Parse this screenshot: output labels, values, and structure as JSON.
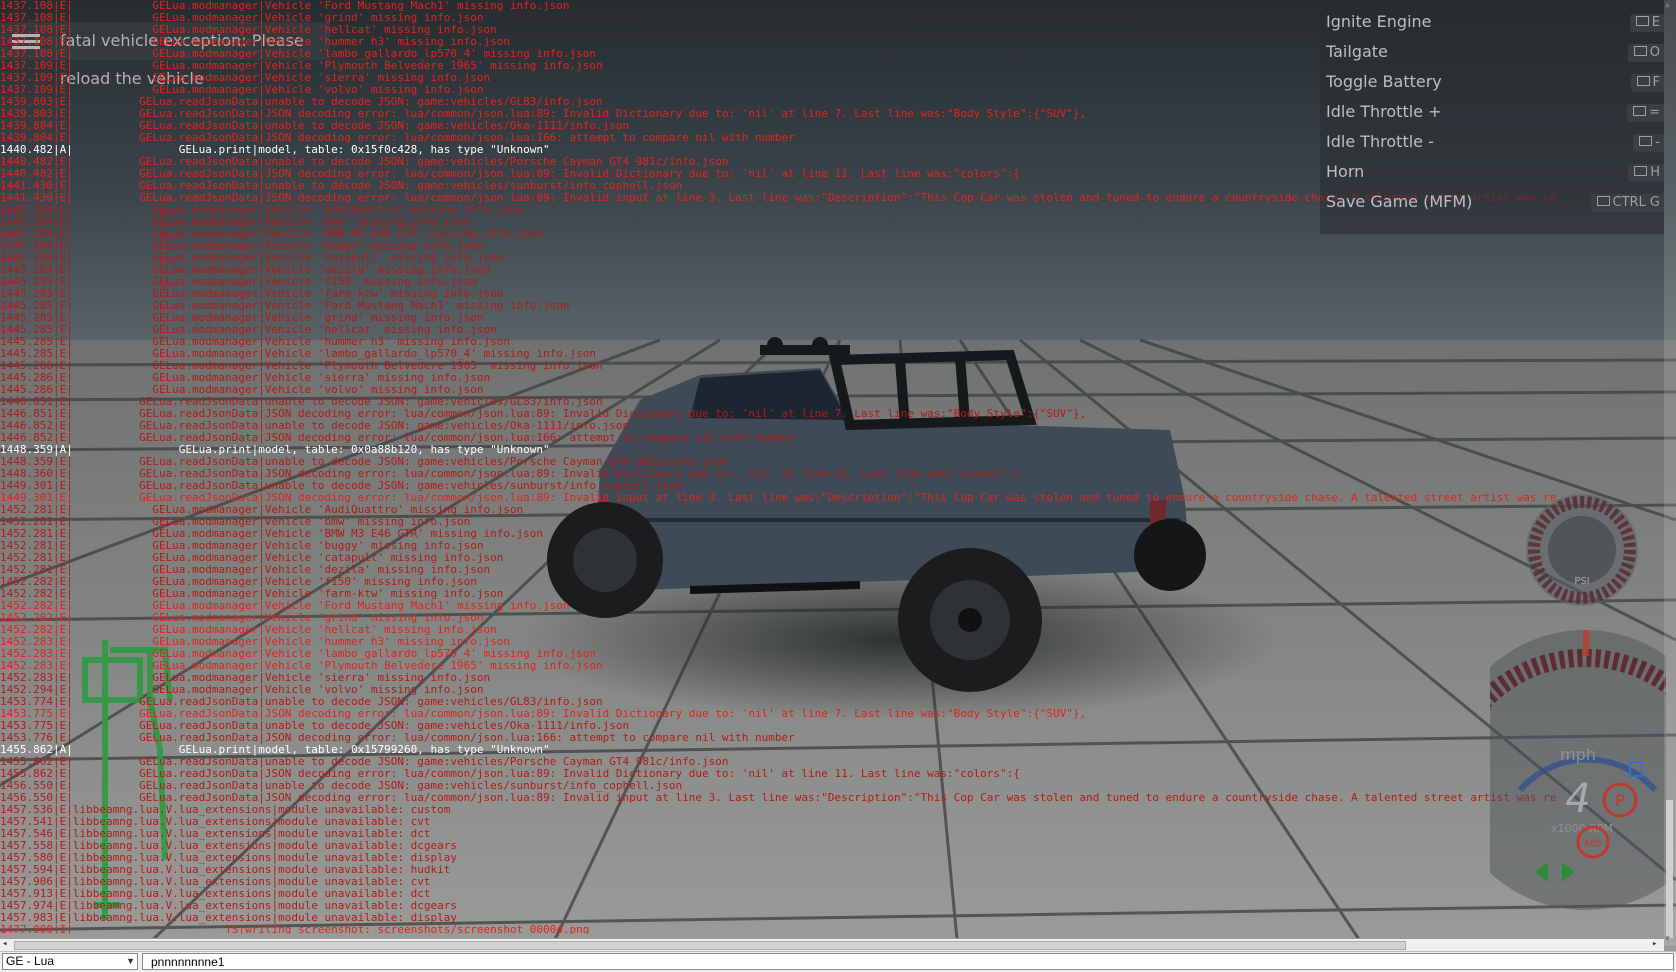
{
  "notice": {
    "text": "fatal vehicle exception: Please reload the vehicle"
  },
  "action_menu": [
    {
      "label": "Ignite Engine",
      "key": "E"
    },
    {
      "label": "Tailgate",
      "key": "O"
    },
    {
      "label": "Toggle Battery",
      "key": "F"
    },
    {
      "label": "Idle Throttle +",
      "key": "="
    },
    {
      "label": "Idle Throttle -",
      "key": "-"
    },
    {
      "label": "Horn",
      "key": "H"
    },
    {
      "label": "Save Game (MFM)",
      "key": "CTRL G"
    }
  ],
  "console_lines": [
    {
      "t": "1437.108|E|            GELua.modmanager|Vehicle 'Ford Mustang Mach1' missing info.json",
      "s": "err"
    },
    {
      "t": "1437.108|E|            GELua.modmanager|Vehicle 'grind' missing info.json",
      "s": "err"
    },
    {
      "t": "1437.108|E|            GELua.modmanager|Vehicle 'hellcat' missing info.json",
      "s": "err"
    },
    {
      "t": "1437.108|E|            GELua.modmanager|Vehicle 'hummer h3' missing info.json",
      "s": "err"
    },
    {
      "t": "1437.108|E|            GELua.modmanager|Vehicle 'lambo_gallardo_lp570_4' missing info.json",
      "s": "err"
    },
    {
      "t": "1437.109|E|            GELua.modmanager|Vehicle 'Plymouth Belvedere 1965' missing info.json",
      "s": "err"
    },
    {
      "t": "1437.109|E|            GELua.modmanager|Vehicle 'sierra' missing info.json",
      "s": "err"
    },
    {
      "t": "1437.109|E|            GELua.modmanager|Vehicle 'volvo' missing info.json",
      "s": "err"
    },
    {
      "t": "1439.803|E|          GELua.readJsonData|unable to decode JSON: game:vehicles/GL83/info.json",
      "s": "err"
    },
    {
      "t": "1439.803|E|          GELua.readJsonData|JSON decoding error: lua/common/json.lua:89: Invalid Dictionary due to: 'nil' at line 7. Last line was:\"Body Style\":{\"SUV\"},",
      "s": "err"
    },
    {
      "t": "1439.804|E|          GELua.readJsonData|unable to decode JSON: game:vehicles/Oka-1111/info.json",
      "s": "err"
    },
    {
      "t": "1439.804|E|          GELua.readJsonData|JSON decoding error: lua/common/json.lua:166: attempt to compare nil with number",
      "s": "err"
    },
    {
      "t": "1440.482|A|                GELua.print|model, table: 0x15f0c428, has type \"Unknown\"",
      "s": "info"
    },
    {
      "t": "1440.482|E|          GELua.readJsonData|unable to decode JSON: game:vehicles/Porsche Cayman GT4 981c/info.json",
      "s": "err"
    },
    {
      "t": "1440.482|E|          GELua.readJsonData|JSON decoding error: lua/common/json.lua:89: Invalid Dictionary due to: 'nil' at line 11. Last line was:\"colors\":{",
      "s": "err"
    },
    {
      "t": "1441.430|E|          GELua.readJsonData|unable to decode JSON: game:vehicles/sunburst/info_cophell.json",
      "s": "err"
    },
    {
      "t": "1441.430|E|          GELua.readJsonData|JSON decoding error: lua/common/json.lua:89: Invalid input at line 3. Last line was:\"Description\":\"This Cop Car was stolen and tuned to endure a countryside chase. A talented street artist was re",
      "s": "err"
    },
    {
      "t": "1445.284|E|            GELua.modmanager|Vehicle 'AudiQuattro' missing info.json",
      "s": "faint"
    },
    {
      "t": "1445.284|E|            GELua.modmanager|Vehicle 'bmw' missing info.json",
      "s": "faint"
    },
    {
      "t": "1445.284|E|            GELua.modmanager|Vehicle 'BMW M3 E46 GTR' missing info.json",
      "s": "faint"
    },
    {
      "t": "1445.284|E|            GELua.modmanager|Vehicle 'buggy' missing info.json",
      "s": "faint"
    },
    {
      "t": "1445.284|E|            GELua.modmanager|Vehicle 'catapult' missing info.json",
      "s": "faint"
    },
    {
      "t": "1445.284|E|            GELua.modmanager|Vehicle 'dezila' missing info.json",
      "s": "faint"
    },
    {
      "t": "1445.285|E|            GELua.modmanager|Vehicle 'f150' missing info.json",
      "s": "faint"
    },
    {
      "t": "1445.285|E|            GELua.modmanager|Vehicle 'farm-ktw' missing info.json",
      "s": "faint"
    },
    {
      "t": "1445.285|E|            GELua.modmanager|Vehicle 'Ford Mustang Mach1' missing info.json",
      "s": "faint"
    },
    {
      "t": "1445.285|E|            GELua.modmanager|Vehicle 'grind' missing info.json",
      "s": "faint"
    },
    {
      "t": "1445.285|E|            GELua.modmanager|Vehicle 'hellcat' missing info.json",
      "s": "faint"
    },
    {
      "t": "1445.285|E|            GELua.modmanager|Vehicle 'hummer h3' missing info.json",
      "s": "faint"
    },
    {
      "t": "1445.285|E|            GELua.modmanager|Vehicle 'lambo_gallardo_lp570_4' missing info.json",
      "s": "faint"
    },
    {
      "t": "1445.286|E|            GELua.modmanager|Vehicle 'Plymouth Belvedere 1965' missing info.json",
      "s": "faint"
    },
    {
      "t": "1445.286|E|            GELua.modmanager|Vehicle 'sierra' missing info.json",
      "s": "faint"
    },
    {
      "t": "1445.286|E|            GELua.modmanager|Vehicle 'volvo' missing info.json",
      "s": "faint"
    },
    {
      "t": "1446.851|E|          GELua.readJsonData|unable to decode JSON: game:vehicles/GL83/info.json",
      "s": "faint"
    },
    {
      "t": "1446.851|E|          GELua.readJsonData|JSON decoding error: lua/common/json.lua:89: Invalid Dictionary due to: 'nil' at line 7. Last line was:\"Body Style\":{\"SUV\"},",
      "s": "faint"
    },
    {
      "t": "1446.852|E|          GELua.readJsonData|unable to decode JSON: game:vehicles/Oka-1111/info.json",
      "s": "faint"
    },
    {
      "t": "1446.852|E|          GELua.readJsonData|JSON decoding error: lua/common/json.lua:166: attempt to compare nil with number",
      "s": "faint"
    },
    {
      "t": "1448.359|A|                GELua.print|model, table: 0x0a88b120, has type \"Unknown\"",
      "s": "info"
    },
    {
      "t": "1448.359|E|          GELua.readJsonData|unable to decode JSON: game:vehicles/Porsche Cayman GT4 981c/info.json",
      "s": "faint"
    },
    {
      "t": "1448.360|E|          GELua.readJsonData|JSON decoding error: lua/common/json.lua:89: Invalid Dictionary due to: 'nil' at line 11. Last line was:\"colors\":{",
      "s": "faint"
    },
    {
      "t": "1449.301|E|          GELua.readJsonData|unable to decode JSON: game:vehicles/sunburst/info_cophell.json",
      "s": "faint"
    },
    {
      "t": "1449.301|E|          GELua.readJsonData|JSON decoding error: lua/common/json.lua:89: Invalid input at line 3. Last line was:\"Description\":\"This Cop Car was stolen and tuned to endure a countryside chase. A talented street artist was re",
      "s": "err"
    },
    {
      "t": "1452.281|E|            GELua.modmanager|Vehicle 'AudiQuattro' missing info.json",
      "s": "faint"
    },
    {
      "t": "1452.281|E|            GELua.modmanager|Vehicle 'bmw' missing info.json",
      "s": "faint"
    },
    {
      "t": "1452.281|E|            GELua.modmanager|Vehicle 'BMW M3 E46 GTR' missing info.json",
      "s": "faint"
    },
    {
      "t": "1452.281|E|            GELua.modmanager|Vehicle 'buggy' missing info.json",
      "s": "faint"
    },
    {
      "t": "1452.281|E|            GELua.modmanager|Vehicle 'catapult' missing info.json",
      "s": "faint"
    },
    {
      "t": "1452.281|E|            GELua.modmanager|Vehicle 'dezila' missing info.json",
      "s": "faint"
    },
    {
      "t": "1452.282|E|            GELua.modmanager|Vehicle 'f150' missing info.json",
      "s": "faint"
    },
    {
      "t": "1452.282|E|            GELua.modmanager|Vehicle 'farm-ktw' missing info.json",
      "s": "faint"
    },
    {
      "t": "1452.282|E|            GELua.modmanager|Vehicle 'Ford Mustang Mach1' missing info.json",
      "s": "err"
    },
    {
      "t": "1452.282|E|            GELua.modmanager|Vehicle 'grind' missing info.json",
      "s": "err"
    },
    {
      "t": "1452.282|E|            GELua.modmanager|Vehicle 'hellcat' missing info.json",
      "s": "err"
    },
    {
      "t": "1452.283|E|            GELua.modmanager|Vehicle 'hummer h3' missing info.json",
      "s": "err"
    },
    {
      "t": "1452.283|E|            GELua.modmanager|Vehicle 'lambo_gallardo_lp570_4' missing info.json",
      "s": "err"
    },
    {
      "t": "1452.283|E|            GELua.modmanager|Vehicle 'Plymouth Belvedere 1965' missing info.json",
      "s": "err"
    },
    {
      "t": "1452.283|E|            GELua.modmanager|Vehicle 'sierra' missing info.json",
      "s": "faint"
    },
    {
      "t": "1452.294|E|            GELua.modmanager|Vehicle 'volvo' missing info.json",
      "s": "faint"
    },
    {
      "t": "1453.774|E|          GELua.readJsonData|unable to decode JSON: game:vehicles/GL83/info.json",
      "s": "faint"
    },
    {
      "t": "1453.775|E|          GELua.readJsonData|JSON decoding error: lua/common/json.lua:89: Invalid Dictionary due to: 'nil' at line 7. Last line was:\"Body Style\":{\"SUV\"},",
      "s": "err"
    },
    {
      "t": "1453.775|E|          GELua.readJsonData|unable to decode JSON: game:vehicles/Oka-1111/info.json",
      "s": "faint"
    },
    {
      "t": "1453.776|E|          GELua.readJsonData|JSON decoding error: lua/common/json.lua:166: attempt to compare nil with number",
      "s": "faint"
    },
    {
      "t": "1455.862|A|                GELua.print|model, table: 0x15799260, has type \"Unknown\"",
      "s": "info"
    },
    {
      "t": "1455.862|E|          GELua.readJsonData|unable to decode JSON: game:vehicles/Porsche Cayman GT4 981c/info.json",
      "s": "faint"
    },
    {
      "t": "1455.862|E|          GELua.readJsonData|JSON decoding error: lua/common/json.lua:89: Invalid Dictionary due to: 'nil' at line 11. Last line was:\"colors\":{",
      "s": "faint"
    },
    {
      "t": "1456.550|E|          GELua.readJsonData|unable to decode JSON: game:vehicles/sunburst/info_cophell.json",
      "s": "faint"
    },
    {
      "t": "1456.550|E|          GELua.readJsonData|JSON decoding error: lua/common/json.lua:89: Invalid input at line 3. Last line was:\"Description\":\"This Cop Car was stolen and tuned to endure a countryside chase. A talented street artist was re",
      "s": "faint"
    },
    {
      "t": "1457.536|E|libbeamng.lua.V.lua_extensions|module unavailable: custom",
      "s": "faint"
    },
    {
      "t": "1457.541|E|libbeamng.lua.V.lua_extensions|module unavailable: cvt",
      "s": "faint"
    },
    {
      "t": "1457.546|E|libbeamng.lua.V.lua_extensions|module unavailable: dct",
      "s": "faint"
    },
    {
      "t": "1457.558|E|libbeamng.lua.V.lua_extensions|module unavailable: dcgears",
      "s": "faint"
    },
    {
      "t": "1457.580|E|libbeamng.lua.V.lua_extensions|module unavailable: display",
      "s": "faint"
    },
    {
      "t": "1457.594|E|libbeamng.lua.V.lua_extensions|module unavailable: hudkit",
      "s": "faint"
    },
    {
      "t": "1457.906|E|libbeamng.lua.V.lua_extensions|module unavailable: cvt",
      "s": "faint"
    },
    {
      "t": "1457.913|E|libbeamng.lua.V.lua_extensions|module unavailable: dct",
      "s": "faint"
    },
    {
      "t": "1457.974|E|libbeamng.lua.V.lua_extensions|module unavailable: dcgears",
      "s": "faint"
    },
    {
      "t": "1457.983|E|libbeamng.lua.V.lua_extensions|module unavailable: display",
      "s": "faint"
    },
    {
      "t": "1477.008|I|                       TS|writing screenshot: screenshots/screenshot_00004.png",
      "s": "err"
    }
  ],
  "gauges": {
    "psi_label": "PSI",
    "unit_label": "mph",
    "gear": "4",
    "rpm_label": "x1000 RPM",
    "abs_label": "ABS",
    "park_label": "P"
  },
  "footer": {
    "context_select": "GE - Lua",
    "command_input": "pnnnnnnnne1"
  },
  "colors": {
    "log_error": "#e3221e",
    "log_info": "#ffffff",
    "ground": "#8c8d8a",
    "sky_top": "#2b3236"
  }
}
